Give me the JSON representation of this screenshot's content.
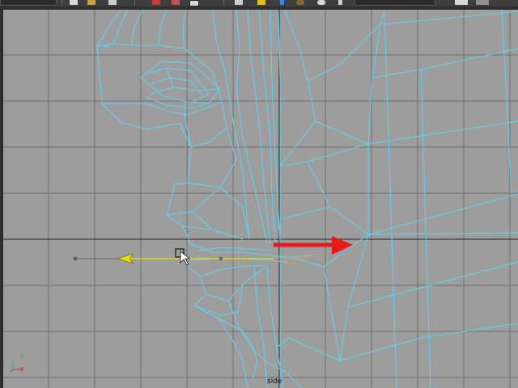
{
  "app": {
    "viewport_label": "side"
  },
  "axis_indicator": {
    "vertical_axis": "z",
    "horizontal_axis": "x",
    "vertical_color": "#2dbb2d",
    "horizontal_color": "#d42a2a"
  },
  "toolbar": {
    "icons": [
      "file-new-icon",
      "folder-open-icon",
      "save-icon",
      "select-tool-icon",
      "move-tool-icon",
      "rotate-tool-icon",
      "snap-grid-icon",
      "snap-curve-icon",
      "snap-point-icon",
      "render-icon",
      "sphere-icon",
      "dropdown-icon"
    ]
  },
  "colors": {
    "viewport_bg": "#9d9d9d",
    "grid": "#707070",
    "wireframe": "#5fd4ee",
    "manipulator_arrow": "#e61a1a",
    "handle_yellow": "#f0e000"
  }
}
